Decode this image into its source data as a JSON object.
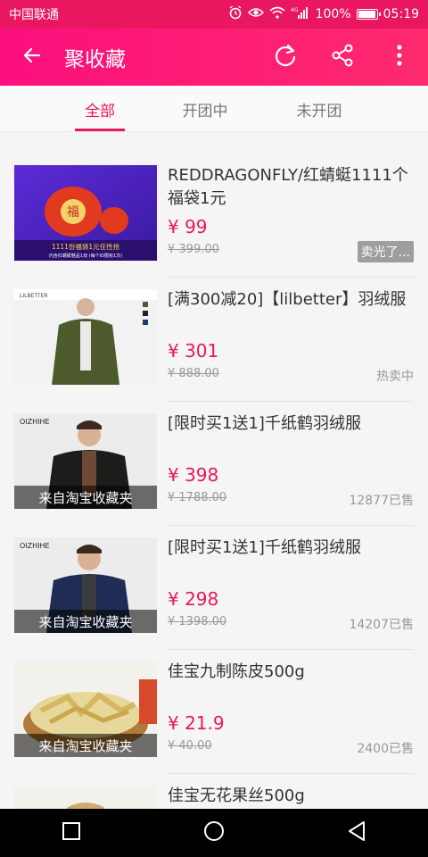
{
  "status_bar": {
    "carrier": "中国联通",
    "battery": "100%",
    "battery_level": 1.0,
    "time": "05:19",
    "signal": "4G"
  },
  "app_bar": {
    "title": "聚收藏",
    "back_icon": "arrow-left-icon",
    "refresh_icon": "refresh-icon",
    "share_icon": "share-icon",
    "more_icon": "more-vertical-icon"
  },
  "tabs": [
    {
      "label": "全部",
      "active": true
    },
    {
      "label": "开团中",
      "active": false
    },
    {
      "label": "未开团",
      "active": false
    }
  ],
  "items": [
    {
      "title": "REDDRAGONFLY/红蜻蜓1111个福袋1元",
      "price": "¥ 99",
      "original_price": "¥ 399.00",
      "status": "卖光了...",
      "caption": "",
      "thumb_text_main": "1111份福袋1元任性抢",
      "thumb_text_sub": "内含红蜻蜓鞋品1双 (每个ID限抢1次)"
    },
    {
      "title": "[满300减20]【lilbetter】羽绒服",
      "price": "¥ 301",
      "original_price": "¥ 888.00",
      "status": "热卖中",
      "caption": "",
      "thumb_text_main": "LILBETTER"
    },
    {
      "title": "[限时买1送1]千纸鹤羽绒服",
      "price": "¥ 398",
      "original_price": "¥ 1788.00",
      "status": "12877已售",
      "caption": "来自淘宝收藏夹",
      "thumb_text_main": "OIZHIHE"
    },
    {
      "title": "[限时买1送1]千纸鹤羽绒服",
      "price": "¥ 298",
      "original_price": "¥ 1398.00",
      "status": "14207已售",
      "caption": "来自淘宝收藏夹",
      "thumb_text_main": "OIZHIHE"
    },
    {
      "title": "佳宝九制陈皮500g",
      "price": "¥ 21.9",
      "original_price": "¥ 40.00",
      "status": "2400已售",
      "caption": "来自淘宝收藏夹"
    },
    {
      "title": "佳宝无花果丝500g",
      "price": "",
      "original_price": "",
      "status": "",
      "caption": ""
    }
  ],
  "nav_bar": {
    "recents_icon": "square-icon",
    "home_icon": "circle-icon",
    "back_icon": "triangle-back-icon"
  }
}
